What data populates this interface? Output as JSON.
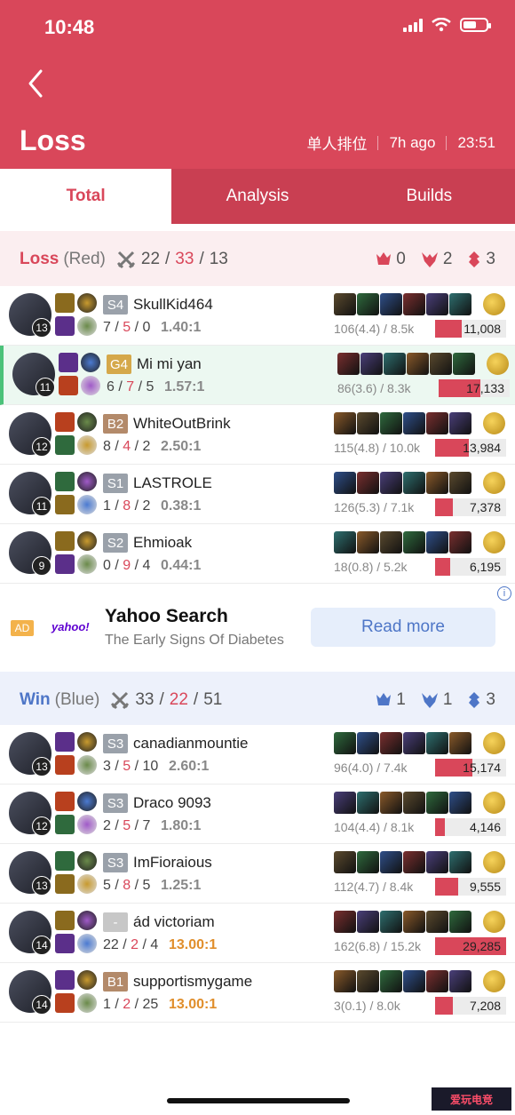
{
  "status_bar": {
    "time": "10:48"
  },
  "header": {
    "title": "Loss",
    "queue": "单人排位",
    "ago": "7h ago",
    "duration": "23:51"
  },
  "tabs": [
    {
      "label": "Total",
      "active": true
    },
    {
      "label": "Analysis",
      "active": false
    },
    {
      "label": "Builds",
      "active": false
    }
  ],
  "colors": {
    "accent": "#d9475a",
    "blue": "#4e76c7",
    "highlight": "#4cc27a"
  },
  "teams": [
    {
      "result": "Loss",
      "side": "(Red)",
      "kills": "22",
      "deaths": "33",
      "assists": "13",
      "objectives": {
        "baron": "0",
        "dragon": "2",
        "tower": "3"
      },
      "players": [
        {
          "level": "13",
          "tier": "S4",
          "name": "SkullKid464",
          "k": "7",
          "d": "5",
          "a": "0",
          "ratio": "1.40:1",
          "cs": "106(4.4) / 8.5k",
          "damage": "11,008",
          "damage_fraction": 0.38,
          "highlight": false,
          "gold_ratio": false
        },
        {
          "level": "11",
          "tier": "G4",
          "name": "Mi mi yan",
          "k": "6",
          "d": "7",
          "a": "5",
          "ratio": "1.57:1",
          "cs": "86(3.6) / 8.3k",
          "damage": "17,133",
          "damage_fraction": 0.59,
          "highlight": true,
          "gold_ratio": false
        },
        {
          "level": "12",
          "tier": "B2",
          "name": "WhiteOutBrink",
          "k": "8",
          "d": "4",
          "a": "2",
          "ratio": "2.50:1",
          "cs": "115(4.8) / 10.0k",
          "damage": "13,984",
          "damage_fraction": 0.48,
          "highlight": false,
          "gold_ratio": false
        },
        {
          "level": "11",
          "tier": "S1",
          "name": "LASTROLE",
          "k": "1",
          "d": "8",
          "a": "2",
          "ratio": "0.38:1",
          "cs": "126(5.3) / 7.1k",
          "damage": "7,378",
          "damage_fraction": 0.25,
          "highlight": false,
          "gold_ratio": false
        },
        {
          "level": "9",
          "tier": "S2",
          "name": "Ehmioak",
          "k": "0",
          "d": "9",
          "a": "4",
          "ratio": "0.44:1",
          "cs": "18(0.8) / 5.2k",
          "damage": "6,195",
          "damage_fraction": 0.21,
          "highlight": false,
          "gold_ratio": false
        }
      ]
    },
    {
      "result": "Win",
      "side": "(Blue)",
      "kills": "33",
      "deaths": "22",
      "assists": "51",
      "objectives": {
        "baron": "1",
        "dragon": "1",
        "tower": "3"
      },
      "players": [
        {
          "level": "13",
          "tier": "S3",
          "name": "canadianmountie",
          "k": "3",
          "d": "5",
          "a": "10",
          "ratio": "2.60:1",
          "cs": "96(4.0) / 7.4k",
          "damage": "15,174",
          "damage_fraction": 0.52,
          "highlight": false,
          "gold_ratio": false
        },
        {
          "level": "12",
          "tier": "S3",
          "name": "Draco 9093",
          "k": "2",
          "d": "5",
          "a": "7",
          "ratio": "1.80:1",
          "cs": "104(4.4) / 8.1k",
          "damage": "4,146",
          "damage_fraction": 0.14,
          "highlight": false,
          "gold_ratio": false
        },
        {
          "level": "13",
          "tier": "S3",
          "name": "ImFioraious",
          "k": "5",
          "d": "8",
          "a": "5",
          "ratio": "1.25:1",
          "cs": "112(4.7) / 8.4k",
          "damage": "9,555",
          "damage_fraction": 0.33,
          "highlight": false,
          "gold_ratio": false
        },
        {
          "level": "14",
          "tier": "-",
          "name": "ád victoriam",
          "k": "22",
          "d": "2",
          "a": "4",
          "ratio": "13.00:1",
          "cs": "162(6.8) / 15.2k",
          "damage": "29,285",
          "damage_fraction": 1.0,
          "highlight": false,
          "gold_ratio": true
        },
        {
          "level": "14",
          "tier": "B1",
          "name": "supportismygame",
          "k": "1",
          "d": "2",
          "a": "25",
          "ratio": "13.00:1",
          "cs": "3(0.1) / 8.0k",
          "damage": "7,208",
          "damage_fraction": 0.25,
          "highlight": false,
          "gold_ratio": true
        }
      ]
    }
  ],
  "ad": {
    "badge": "AD",
    "brand": "yahoo!",
    "title": "Yahoo Search",
    "subtitle": "The Early Signs Of Diabetes",
    "cta": "Read more",
    "info": "i"
  },
  "watermark": "爱玩电竞"
}
